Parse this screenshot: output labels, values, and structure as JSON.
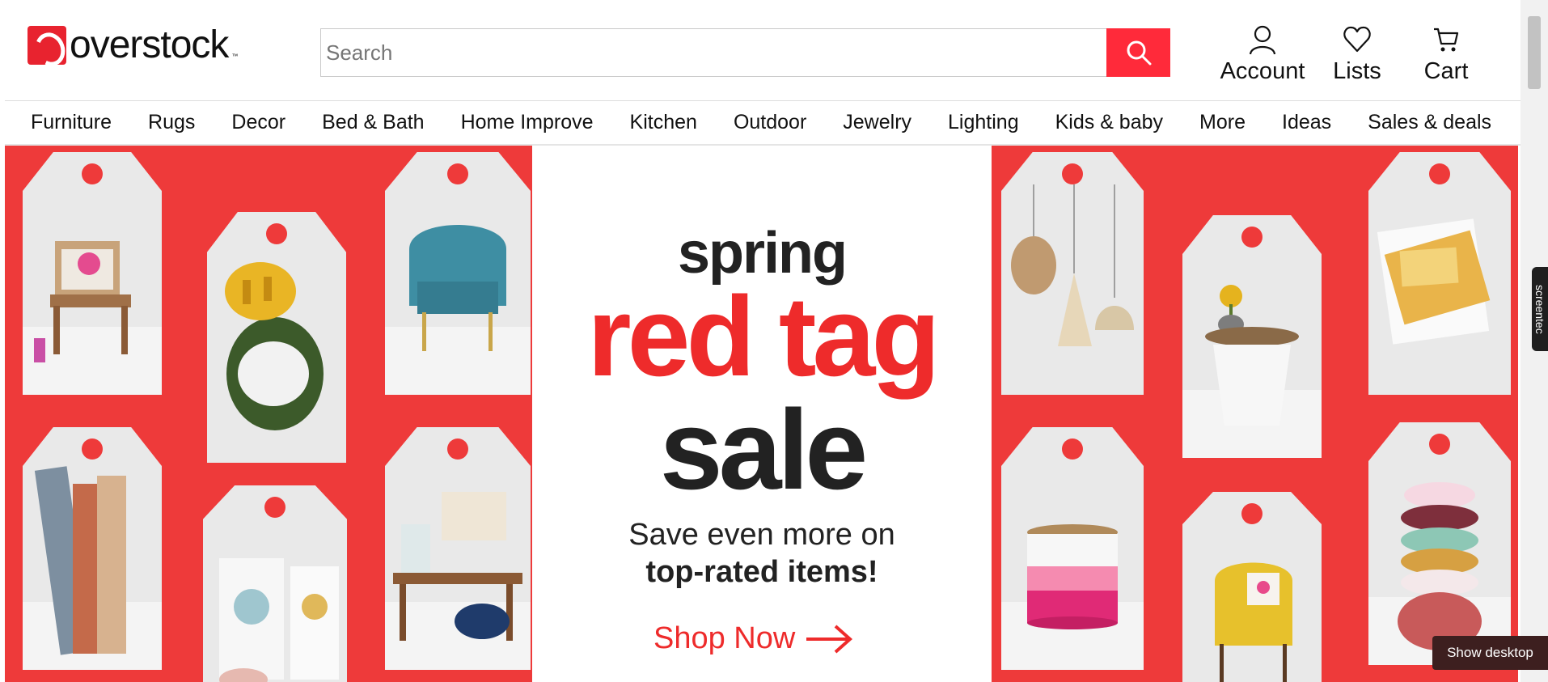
{
  "brand": {
    "name": "overstock",
    "tm": "™",
    "color": "#e8232f"
  },
  "search": {
    "placeholder": "Search",
    "value": "",
    "button_color": "#ff2a3a"
  },
  "header_actions": {
    "account": {
      "label": "Account",
      "icon": "user-icon"
    },
    "lists": {
      "label": "Lists",
      "icon": "heart-icon"
    },
    "cart": {
      "label": "Cart",
      "icon": "cart-icon"
    }
  },
  "nav": {
    "items": [
      "Furniture",
      "Rugs",
      "Decor",
      "Bed & Bath",
      "Home Improve",
      "Kitchen",
      "Outdoor",
      "Jewelry",
      "Lighting",
      "Kids & baby",
      "More",
      "Ideas",
      "Sales & deals"
    ]
  },
  "hero": {
    "line1": "spring",
    "line2": "red tag",
    "line3": "sale",
    "sub1": "Save even more on",
    "sub2": "top-rated items!",
    "cta": "Shop Now",
    "accent": "#ee2b2b",
    "background": "#ee3a3a"
  },
  "overlay": {
    "screentec": "screentec",
    "show_desktop": "Show desktop"
  }
}
